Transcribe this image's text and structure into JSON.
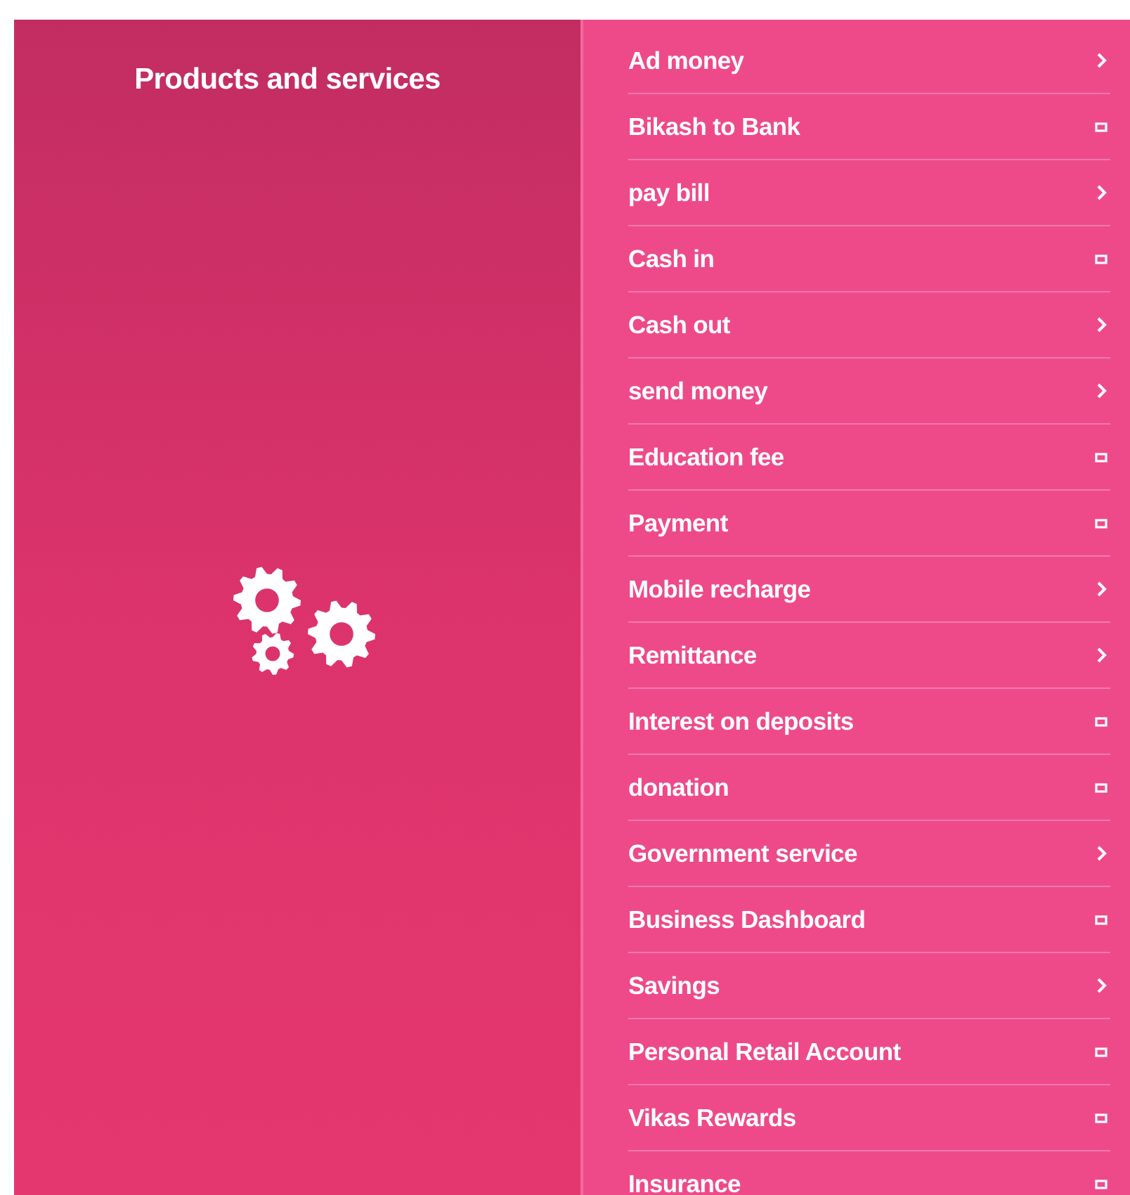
{
  "panel": {
    "title": "Products and services"
  },
  "menu": {
    "items": [
      {
        "label": "Ad money",
        "kind": "arrow"
      },
      {
        "label": "Bikash to Bank",
        "kind": "square"
      },
      {
        "label": "pay bill",
        "kind": "arrow"
      },
      {
        "label": "Cash in",
        "kind": "square"
      },
      {
        "label": "Cash out",
        "kind": "arrow"
      },
      {
        "label": "send money",
        "kind": "arrow"
      },
      {
        "label": "Education fee",
        "kind": "square"
      },
      {
        "label": "Payment",
        "kind": "square"
      },
      {
        "label": "Mobile recharge",
        "kind": "arrow"
      },
      {
        "label": "Remittance",
        "kind": "arrow"
      },
      {
        "label": "Interest on deposits",
        "kind": "square"
      },
      {
        "label": "donation",
        "kind": "square"
      },
      {
        "label": "Government service",
        "kind": "arrow"
      },
      {
        "label": "Business Dashboard",
        "kind": "square"
      },
      {
        "label": "Savings",
        "kind": "arrow"
      },
      {
        "label": "Personal Retail Account",
        "kind": "square"
      },
      {
        "label": "Vikas Rewards",
        "kind": "square"
      },
      {
        "label": "Insurance",
        "kind": "square"
      }
    ]
  }
}
